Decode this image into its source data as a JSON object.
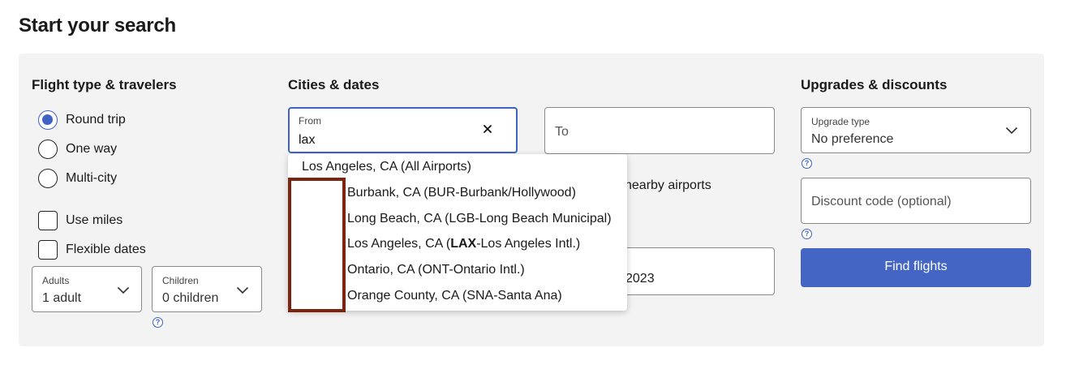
{
  "page_title": "Start your search",
  "travelers": {
    "section_title": "Flight type & travelers",
    "trip_types": [
      {
        "label": "Round trip",
        "selected": true
      },
      {
        "label": "One way",
        "selected": false
      },
      {
        "label": "Multi-city",
        "selected": false
      }
    ],
    "use_miles_label": "Use miles",
    "flexible_dates_label": "Flexible dates",
    "adults": {
      "label": "Adults",
      "value": "1 adult"
    },
    "children": {
      "label": "Children",
      "value": "0 children"
    },
    "help_icon": "?"
  },
  "cities": {
    "section_title": "Cities & dates",
    "from": {
      "label": "From",
      "value": "lax"
    },
    "to": {
      "placeholder": "To"
    },
    "nearby_text": "nearby airports",
    "date_value": "2023",
    "suggestions": [
      {
        "text": "Los Angeles, CA (All Airports)"
      },
      {
        "text": "Burbank, CA (BUR-Burbank/Hollywood)"
      },
      {
        "text": "Long Beach, CA (LGB-Long Beach Municipal)"
      },
      {
        "pre": "Los Angeles, CA (",
        "bold": "LAX",
        "post": "-Los Angeles Intl.)"
      },
      {
        "text": "Ontario, CA (ONT-Ontario Intl.)"
      },
      {
        "text": "Orange County, CA (SNA-Santa Ana)"
      }
    ]
  },
  "upgrades": {
    "section_title": "Upgrades & discounts",
    "upgrade_type": {
      "label": "Upgrade type",
      "value": "No preference"
    },
    "discount_placeholder": "Discount code (optional)",
    "find_button_label": "Find flights"
  },
  "colors": {
    "accent": "#3f63c3",
    "button": "#4565c4",
    "highlight_border": "#7b2410",
    "panel_bg": "#f3f3f3"
  }
}
